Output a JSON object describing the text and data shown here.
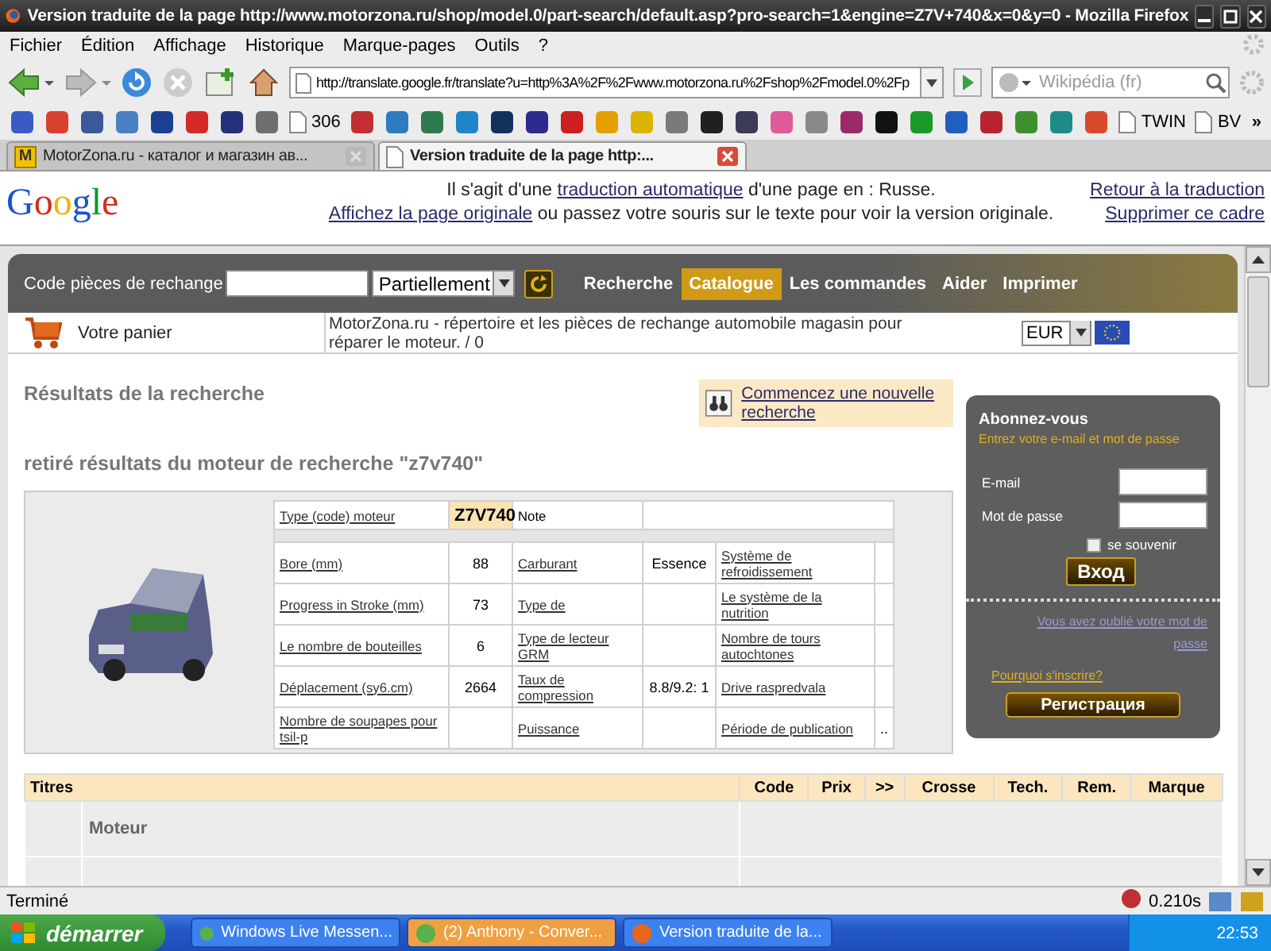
{
  "window": {
    "title": "Version traduite de la page http://www.motorzona.ru/shop/model.0/part-search/default.asp?pro-search=1&engine=Z7V+740&x=0&y=0 - Mozilla Firefox"
  },
  "menu": [
    "Fichier",
    "Édition",
    "Affichage",
    "Historique",
    "Marque-pages",
    "Outils",
    "?"
  ],
  "navigation": {
    "url": "http://translate.google.fr/translate?u=http%3A%2F%2Fwww.motorzona.ru%2Fshop%2Fmodel.0%2Fp",
    "search_placeholder": "Wikipédia (fr)"
  },
  "bookmarks": [
    {
      "kind": "site",
      "color": "#3b5bc4"
    },
    {
      "kind": "site",
      "color": "#d8412f"
    },
    {
      "kind": "site",
      "color": "#3b5998"
    },
    {
      "kind": "site",
      "color": "#4a7fc1"
    },
    {
      "kind": "site",
      "color": "#1c3f94"
    },
    {
      "kind": "site",
      "color": "#d42a2a"
    },
    {
      "kind": "site",
      "color": "#23307a"
    },
    {
      "kind": "site",
      "color": "#6e6e6e"
    },
    {
      "kind": "page",
      "label": "306"
    },
    {
      "kind": "site",
      "color": "#c03030"
    },
    {
      "kind": "site",
      "color": "#2e7bbf"
    },
    {
      "kind": "site",
      "color": "#2f7a4e"
    },
    {
      "kind": "site",
      "color": "#1e86c8"
    },
    {
      "kind": "site",
      "color": "#12325e"
    },
    {
      "kind": "site",
      "color": "#2b2b8c"
    },
    {
      "kind": "site",
      "color": "#cc1f1f"
    },
    {
      "kind": "site",
      "color": "#e5a000"
    },
    {
      "kind": "site",
      "color": "#d9b400"
    },
    {
      "kind": "site",
      "color": "#7a7a7a"
    },
    {
      "kind": "site",
      "color": "#202020"
    },
    {
      "kind": "site",
      "color": "#3a3a5a"
    },
    {
      "kind": "site",
      "color": "#e05a9a"
    },
    {
      "kind": "site",
      "color": "#8a8a8a"
    },
    {
      "kind": "site",
      "color": "#9c2a6a"
    },
    {
      "kind": "site",
      "color": "#111111"
    },
    {
      "kind": "site",
      "color": "#1a9a2a"
    },
    {
      "kind": "site",
      "color": "#1f5fbf"
    },
    {
      "kind": "site",
      "color": "#b8232f"
    },
    {
      "kind": "site",
      "color": "#3f8f2f"
    },
    {
      "kind": "site",
      "color": "#1e8b8b"
    },
    {
      "kind": "site",
      "color": "#d84a2a"
    },
    {
      "kind": "page",
      "label": "TWIN"
    },
    {
      "kind": "page",
      "label": "BV"
    }
  ],
  "bookmarks_more": "»",
  "tabs": [
    {
      "label": "MotorZona.ru - каталог и магазин ав...",
      "favicon": "M",
      "selected": false
    },
    {
      "label": "Version traduite de la page http:...",
      "selected": true
    }
  ],
  "translate_bar": {
    "logo": "Google",
    "message": [
      [
        {
          "kind": "text",
          "text": "Il s'agit d'une "
        },
        {
          "kind": "link",
          "text": "traduction automatique"
        },
        {
          "kind": "text",
          "text": " d'une page en : Russe."
        }
      ],
      [
        {
          "kind": "link",
          "text": "Affichez la page originale"
        },
        {
          "kind": "text",
          "text": " ou passez votre souris sur le texte pour voir la version originale."
        }
      ]
    ],
    "links": [
      "Retour à la traduction",
      "Supprimer ce cadre"
    ]
  },
  "site": {
    "search_label": "Code pièces de rechange",
    "search_mode": "Partiellement",
    "nav": [
      {
        "label": "Recherche",
        "selected": false
      },
      {
        "label": "Catalogue",
        "selected": true
      },
      {
        "label": "Les commandes",
        "selected": false
      },
      {
        "label": "Aider",
        "selected": false
      },
      {
        "label": "Imprimer",
        "selected": false
      }
    ],
    "cart": "Votre panier",
    "description": "MotorZona.ru - répertoire et les pièces de rechange automobile magasin pour réparer le moteur. / 0",
    "currency": "EUR"
  },
  "results": {
    "title": "Résultats de la recherche",
    "new_search": "Commencez une nouvelle recherche",
    "subtitle": "retiré résultats du moteur de recherche \"z7v740\"",
    "engine": {
      "label": "Type (code) moteur",
      "code": "Z7V740",
      "note": "Note"
    },
    "specs": [
      {
        "label": "Bore (mm)",
        "value": "88",
        "label_2": "Carburant",
        "value_2": "Essence",
        "label_3": "Système de refroidissement"
      },
      {
        "label": "Progress in Stroke (mm)",
        "value": "73",
        "label_2": "Type de",
        "label_3": "Le système de la nutrition"
      },
      {
        "label": "Le nombre de bouteilles",
        "value": "6",
        "label_2": "Type de lecteur GRM",
        "label_3": "Nombre de tours autochtones"
      },
      {
        "label": "Déplacement (sy6.cm)",
        "value": "2664",
        "label_2": "Taux de compression",
        "value_2": "8.8/9.2: 1",
        "label_3": "Drive raspredvala"
      },
      {
        "label": "Nombre de soupapes pour tsil-p",
        "label_2": "Puissance",
        "label_3": "Période de publication",
        "value_3": ".."
      }
    ]
  },
  "login": {
    "title": "Abonnez-vous",
    "subtitle": "Entrez votre e-mail et mot de passe",
    "fields": [
      {
        "label": "E-mail"
      },
      {
        "label": "Mot de passe"
      }
    ],
    "remember": {
      "label": "se souvenir",
      "checked": false
    },
    "submit": "Вход",
    "forgot": "Vous avez oublié votre mot de passe",
    "why": "Pourquoi s'inscrire?",
    "register": "Регистрация"
  },
  "parts_table": {
    "columns": [
      "Titres",
      "Code",
      "Prix",
      ">>",
      "Crosse",
      "Tech.",
      "Rem.",
      "Marque"
    ],
    "rows": [
      {
        "title": "Moteur"
      }
    ]
  },
  "status_bar": {
    "text": "Terminé",
    "timing": "0.210s"
  },
  "taskbar": {
    "start": "démarrer",
    "items": [
      {
        "label": "Windows Live Messen...",
        "flashing": false
      },
      {
        "label": "(2) Anthony - Conver...",
        "flashing": true
      },
      {
        "label": "Version traduite de la...",
        "flashing": false
      }
    ],
    "clock": "22:53"
  }
}
